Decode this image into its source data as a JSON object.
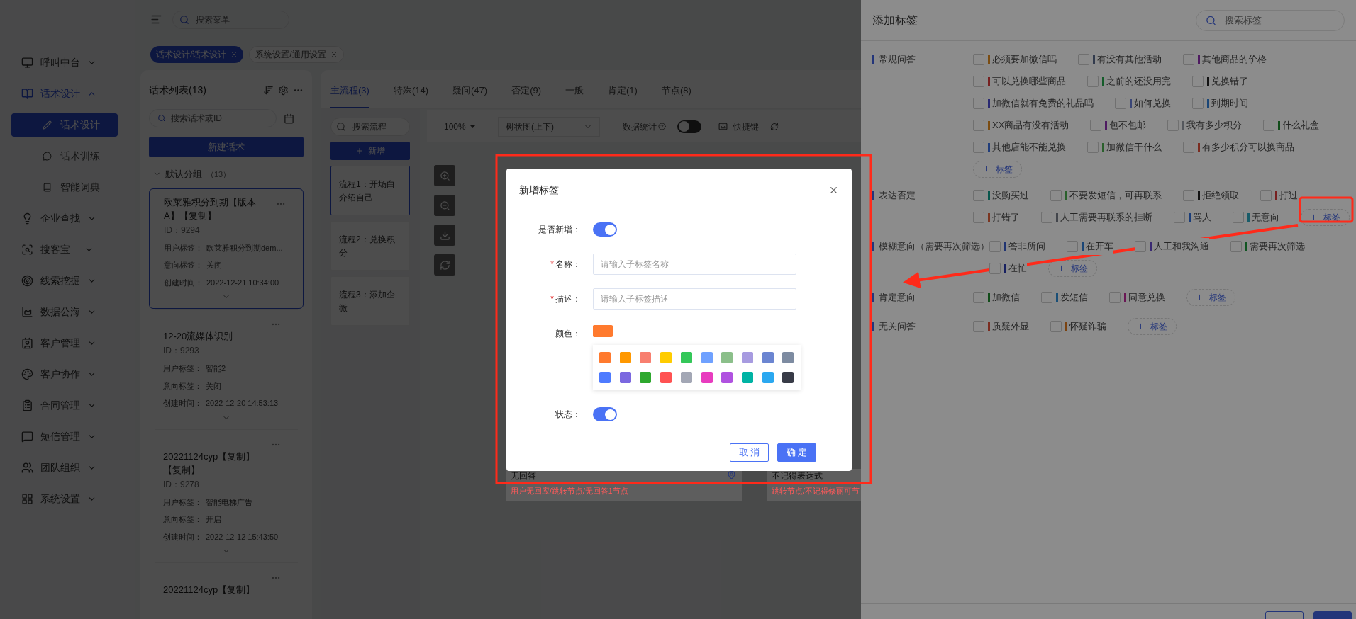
{
  "topbar": {
    "search_placeholder": "搜索菜单"
  },
  "page_tabs": [
    {
      "label": "话术设计/话术设计",
      "selected": true
    },
    {
      "label": "系统设置/通用设置",
      "selected": false
    }
  ],
  "sidebar": {
    "items": [
      {
        "label": "呼叫中台",
        "expanded": false,
        "selected": false
      },
      {
        "label": "话术设计",
        "expanded": true,
        "selected": true,
        "children": [
          {
            "label": "话术设计",
            "selected": true
          },
          {
            "label": "话术训练",
            "selected": false
          },
          {
            "label": "智能词典",
            "selected": false
          }
        ]
      },
      {
        "label": "企业查找",
        "expanded": false,
        "selected": false
      },
      {
        "label": "搜客宝",
        "expanded": false,
        "selected": false
      },
      {
        "label": "线索挖掘",
        "expanded": false,
        "selected": false
      },
      {
        "label": "数据公海",
        "expanded": false,
        "selected": false
      },
      {
        "label": "客户管理",
        "expanded": false,
        "selected": false
      },
      {
        "label": "客户协作",
        "expanded": false,
        "selected": false
      },
      {
        "label": "合同管理",
        "expanded": false,
        "selected": false
      },
      {
        "label": "短信管理",
        "expanded": false,
        "selected": false
      },
      {
        "label": "团队组织",
        "expanded": false,
        "selected": false
      },
      {
        "label": "系统设置",
        "expanded": false,
        "selected": false
      }
    ]
  },
  "script_list": {
    "title": "话术列表(13)",
    "search_placeholder": "搜索话术或ID",
    "new_button": "新建话术",
    "group": {
      "label": "默认分组",
      "count": "（13）"
    },
    "cards": [
      {
        "title": "欧莱雅积分到期【版本A】【复制】",
        "id": "ID：9294",
        "selected": true,
        "fields": [
          {
            "label": "用户标签：",
            "value": "欧莱雅积分到期dem..."
          },
          {
            "label": "意向标签：",
            "value": "关闭"
          },
          {
            "label": "创建时间：",
            "value": "2022-12-21 10:34:00"
          }
        ]
      },
      {
        "title": "12-20流媒体识别",
        "id": "ID：9293",
        "selected": false,
        "fields": [
          {
            "label": "用户标签：",
            "value": "智能2"
          },
          {
            "label": "意向标签：",
            "value": "关闭"
          },
          {
            "label": "创建时间：",
            "value": "2022-12-20 14:53:13"
          }
        ]
      },
      {
        "title": "20221124cyp【复制】【复制】",
        "id": "ID：9278",
        "selected": false,
        "fields": [
          {
            "label": "用户标签：",
            "value": "智能电梯广告"
          },
          {
            "label": "意向标签：",
            "value": "开启"
          },
          {
            "label": "创建时间：",
            "value": "2022-12-12 15:43:50"
          }
        ]
      },
      {
        "title": "20221124cyp【复制】",
        "selected": false
      }
    ]
  },
  "flow_tabs": [
    {
      "label": "主流程(3)",
      "selected": true
    },
    {
      "label": "特殊(14)",
      "selected": false
    },
    {
      "label": "疑问(47)",
      "selected": false
    },
    {
      "label": "否定(9)",
      "selected": false
    },
    {
      "label": "一般",
      "selected": false
    },
    {
      "label": "肯定(1)",
      "selected": false
    },
    {
      "label": "节点(8)",
      "selected": false
    }
  ],
  "flows": {
    "search_placeholder": "搜索流程",
    "add_button": "新增",
    "items": [
      {
        "label": "流程1：开场白介绍自己",
        "selected": true
      },
      {
        "label": "流程2：兑换积分",
        "selected": false
      },
      {
        "label": "流程3：添加企微",
        "selected": false
      }
    ]
  },
  "canvas_toolbar": {
    "zoom": "100%",
    "layout": "树状图(上下)",
    "stats_label": "数据统计",
    "stats_on": false,
    "shortcut": "快捷键"
  },
  "canvas_nodes": [
    {
      "title": "无回答",
      "desc": "用户无回应/跳转节点/无回答1节点"
    },
    {
      "title": "不记得表达式",
      "desc": "跳转节点/不记得修丽可节"
    }
  ],
  "drawer": {
    "title": "添加标签",
    "search_placeholder": "搜索标签",
    "sections": [
      {
        "label": "常规问答",
        "add_button": "标签",
        "items": [
          {
            "label": "必须要加微信吗",
            "color": "#7b4c11",
            "checked": false
          },
          {
            "label": "有没有其他活动",
            "color": "#323b4d",
            "checked": false
          },
          {
            "label": "其他商品的价格",
            "color": "#4e1a61",
            "checked": false
          },
          {
            "label": "可以兑换哪些商品",
            "color": "#772020",
            "checked": false
          },
          {
            "label": "之前的还没用完",
            "color": "#135c29",
            "checked": false
          },
          {
            "label": "兑换错了",
            "color": "#131313",
            "checked": false
          },
          {
            "label": "加微信就有免费的礼品吗",
            "color": "#292972",
            "checked": false
          },
          {
            "label": "如何兑换",
            "color": "#3a4677",
            "checked": false
          },
          {
            "label": "到期时间",
            "color": "#1a4677",
            "checked": false
          },
          {
            "label": "XX商品有没有活动",
            "color": "#7b4c11",
            "checked": false
          },
          {
            "label": "包不包邮",
            "color": "#4e1a61",
            "checked": false
          },
          {
            "label": "我有多少积分",
            "color": "#55585d",
            "checked": false
          },
          {
            "label": "什么礼盒",
            "color": "#114c19",
            "checked": false
          },
          {
            "label": "其他店能不能兑换",
            "color": "#203d7b",
            "checked": false
          },
          {
            "label": "加微信干什么",
            "color": "#2a602c",
            "checked": false
          },
          {
            "label": "有多少积分可以换商品",
            "color": "#7b2c20",
            "checked": false
          }
        ]
      },
      {
        "label": "表达否定",
        "add_button": "标签",
        "items": [
          {
            "label": "没购买过",
            "color": "#08564c",
            "checked": false
          },
          {
            "label": "不要发短信，可再联系",
            "color": "#2a602c",
            "checked": false
          },
          {
            "label": "拒绝领取",
            "color": "#131313",
            "checked": false
          },
          {
            "label": "打过",
            "color": "#772020",
            "checked": false
          },
          {
            "label": "打错了",
            "color": "#7b3520",
            "checked": false
          },
          {
            "label": "人工需要再联系的挂断",
            "color": "#43464c",
            "checked": false
          },
          {
            "label": "骂人",
            "color": "#1a3d7a",
            "checked": false
          },
          {
            "label": "无意向",
            "color": "#185c69",
            "checked": false
          }
        ]
      },
      {
        "label": "模糊意向（需要再次筛选）",
        "add_button": "标签",
        "items": [
          {
            "label": "答非所问",
            "color": "#203472",
            "checked": false
          },
          {
            "label": "在开车",
            "color": "#1a4677",
            "checked": false
          },
          {
            "label": "人工和我沟通",
            "color": "#3a2972",
            "checked": false
          },
          {
            "label": "需要再次筛选",
            "color": "#115522",
            "checked": false
          },
          {
            "label": "在忙",
            "color": "#172061",
            "checked": false
          }
        ]
      },
      {
        "label": "肯定意向",
        "add_button": "标签",
        "items": [
          {
            "label": "加微信",
            "color": "#114c19",
            "checked": false
          },
          {
            "label": "发短信",
            "color": "#1a4f77",
            "checked": false
          },
          {
            "label": "同意兑换",
            "color": "#6a1755",
            "checked": false
          }
        ]
      },
      {
        "label": "无关问答",
        "add_button": "标签",
        "items": [
          {
            "label": "质疑外显",
            "color": "#7b2c20",
            "checked": false
          },
          {
            "label": "怀疑诈骗",
            "color": "#7b4311",
            "checked": false
          }
        ]
      }
    ],
    "buttons": [
      {
        "kind": "secondary"
      },
      {
        "kind": "primary"
      }
    ]
  },
  "modal": {
    "title": "新增标签",
    "fields": [
      {
        "kind": "toggle",
        "label": "是否新增：",
        "on": true
      },
      {
        "kind": "input",
        "label": "名称：",
        "required_mark": "*",
        "placeholder": "请输入子标签名称"
      },
      {
        "kind": "input",
        "label": "描述：",
        "required_mark": "*",
        "placeholder": "请输入子标签描述"
      },
      {
        "kind": "color",
        "label": "颜色：",
        "color": "#ff7a2e",
        "palette": [
          {
            "color": "#ff7a2e"
          },
          {
            "color": "#ff9800"
          },
          {
            "color": "#f87f6f"
          },
          {
            "color": "#ffcc00"
          },
          {
            "color": "#34c759"
          },
          {
            "color": "#6fa1ff"
          },
          {
            "color": "#8bbf8a"
          },
          {
            "color": "#a79be0"
          },
          {
            "color": "#6b85d1"
          },
          {
            "color": "#7d8ba1"
          },
          {
            "color": "#4e7bff"
          },
          {
            "color": "#7b68e0"
          },
          {
            "color": "#2ea82e"
          },
          {
            "color": "#ff5252"
          },
          {
            "color": "#a3a7b5"
          },
          {
            "color": "#e83cbf"
          },
          {
            "color": "#b052e0"
          },
          {
            "color": "#00b3a4"
          },
          {
            "color": "#2ba8f0"
          },
          {
            "color": "#383b47"
          }
        ]
      },
      {
        "kind": "toggle",
        "label": "状态：",
        "on": true
      }
    ],
    "buttons": [
      {
        "label": "取 消",
        "kind": "secondary"
      },
      {
        "label": "确 定",
        "kind": "primary"
      }
    ]
  }
}
